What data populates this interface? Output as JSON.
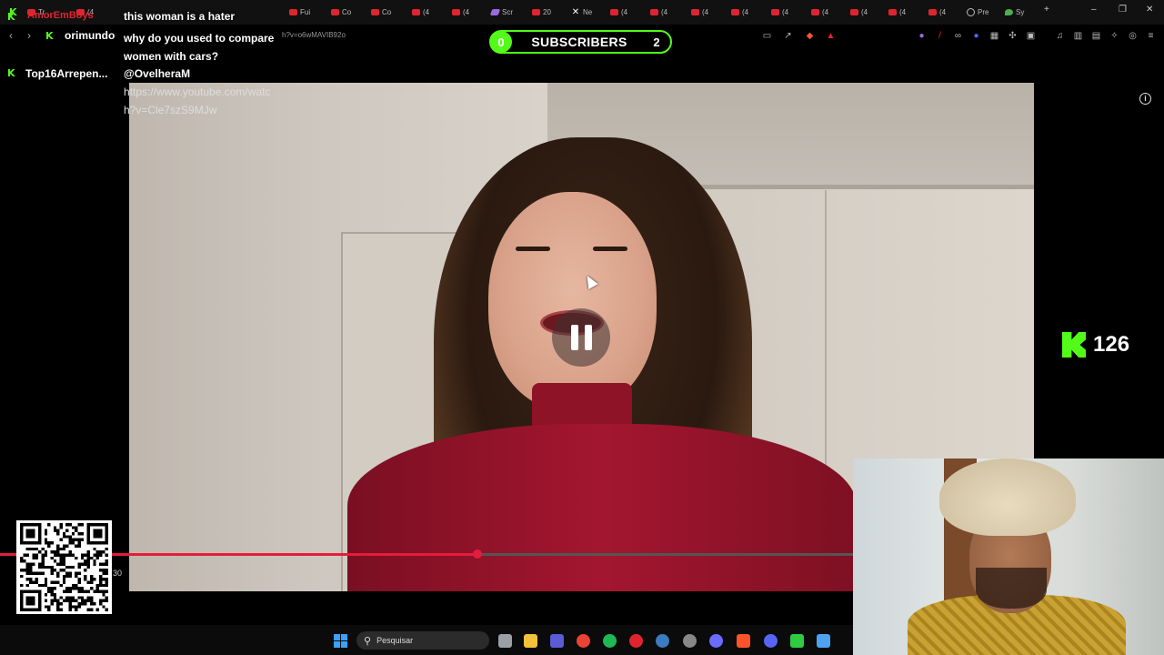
{
  "browser": {
    "tabs": [
      {
        "label": "Tr",
        "favicon": "youtube-icon"
      },
      {
        "label": "(4",
        "favicon": "youtube-icon"
      },
      {
        "label": "Fui",
        "favicon": "youtube-icon"
      },
      {
        "label": "Co",
        "favicon": "youtube-icon"
      },
      {
        "label": "Co",
        "favicon": "youtube-icon"
      },
      {
        "label": "(4",
        "favicon": "youtube-icon"
      },
      {
        "label": "(4",
        "favicon": "youtube-icon"
      },
      {
        "label": "Scr",
        "favicon": "pen-icon"
      },
      {
        "label": "20",
        "favicon": "youtube-icon"
      },
      {
        "label": "Ne",
        "favicon": "x-icon"
      },
      {
        "label": "(4",
        "favicon": "youtube-icon"
      },
      {
        "label": "(4",
        "favicon": "youtube-icon"
      },
      {
        "label": "(4",
        "favicon": "youtube-icon"
      },
      {
        "label": "(4",
        "favicon": "youtube-icon"
      },
      {
        "label": "(4",
        "favicon": "youtube-icon"
      },
      {
        "label": "(4",
        "favicon": "youtube-icon"
      },
      {
        "label": "(4",
        "favicon": "youtube-icon"
      },
      {
        "label": "(4",
        "favicon": "youtube-icon"
      },
      {
        "label": "(4",
        "favicon": "youtube-icon"
      },
      {
        "label": "Pre",
        "favicon": "globe-icon"
      },
      {
        "label": "Sy",
        "favicon": "maps-icon"
      }
    ],
    "new_tab": "+",
    "window_controls": {
      "minimize": "–",
      "restore": "❐",
      "close": "✕"
    },
    "url_fragment": "h?v=o6wMAVIB92o"
  },
  "chat": {
    "messages": [
      {
        "username": "AmorEmBoys",
        "username_color": "#e0242f",
        "text": "this woman is a hater"
      },
      {
        "username": "orimundo",
        "username_color": "#d8d35a",
        "text": "why do you used to compare women with cars?"
      },
      {
        "username": "Top16Arrepen...",
        "username_color": "#f0a33a",
        "text": "@OvelheraM"
      }
    ],
    "link_line1": "https://www.youtube.com/watc",
    "link_line2": "h?v=Cle7szS9MJw"
  },
  "subscribers": {
    "current": "0",
    "label": "SUBSCRIBERS",
    "goal": "2",
    "accent": "#53fc18"
  },
  "viewers": {
    "platform_icon": "kick-logo-icon",
    "count": "126"
  },
  "player": {
    "state": "paused-overlay",
    "progress_fraction": 0.56,
    "time_label": "30",
    "accent": "#e51c3a"
  },
  "taskbar": {
    "search_placeholder": "Pesquisar",
    "apps": [
      "file-explorer-icon",
      "folder-icon",
      "grid-app-icon",
      "chrome-icon",
      "spotify-icon",
      "opera-icon",
      "steam-icon",
      "obs-icon",
      "arrow-app-icon",
      "brave-icon",
      "discord-icon",
      "terminal-icon",
      "notepad-icon"
    ]
  }
}
